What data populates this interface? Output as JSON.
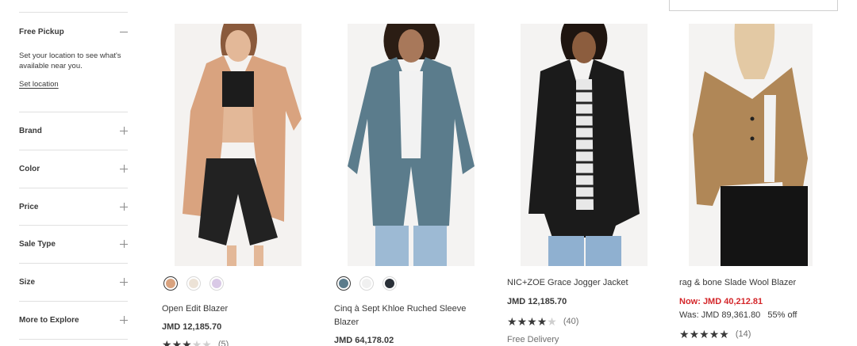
{
  "sidebar": {
    "free_pickup": {
      "title": "Free Pickup",
      "description": "Set your location to see what's available near you.",
      "link": "Set location"
    },
    "filters": [
      "Brand",
      "Color",
      "Price",
      "Sale Type",
      "Size",
      "More to Explore"
    ]
  },
  "products": [
    {
      "name": "Open Edit Blazer",
      "price": "JMD 12,185.70",
      "swatches": [
        "#d9a37f",
        "#ece2d6",
        "#d9c9e6"
      ],
      "rating_count": "(5)",
      "stars": 3
    },
    {
      "name": "Cinq à Sept Khloe Ruched Sleeve Blazer",
      "price": "JMD 64,178.02",
      "swatches": [
        "#5b7c8c",
        "#f0f0f0",
        "#2a3038"
      ]
    },
    {
      "name": "NIC+ZOE Grace Jogger Jacket",
      "price": "JMD 12,185.70",
      "rating_count": "(40)",
      "stars": 4,
      "delivery": "Free Delivery"
    },
    {
      "name": "rag & bone Slade Wool Blazer",
      "price_now": "Now: JMD 40,212.81",
      "price_was": "Was: JMD 89,361.80",
      "discount": "55% off",
      "rating_count": "(14)",
      "stars": 5
    }
  ],
  "colors": {
    "sale_red": "#d4262a",
    "text": "#393939"
  }
}
